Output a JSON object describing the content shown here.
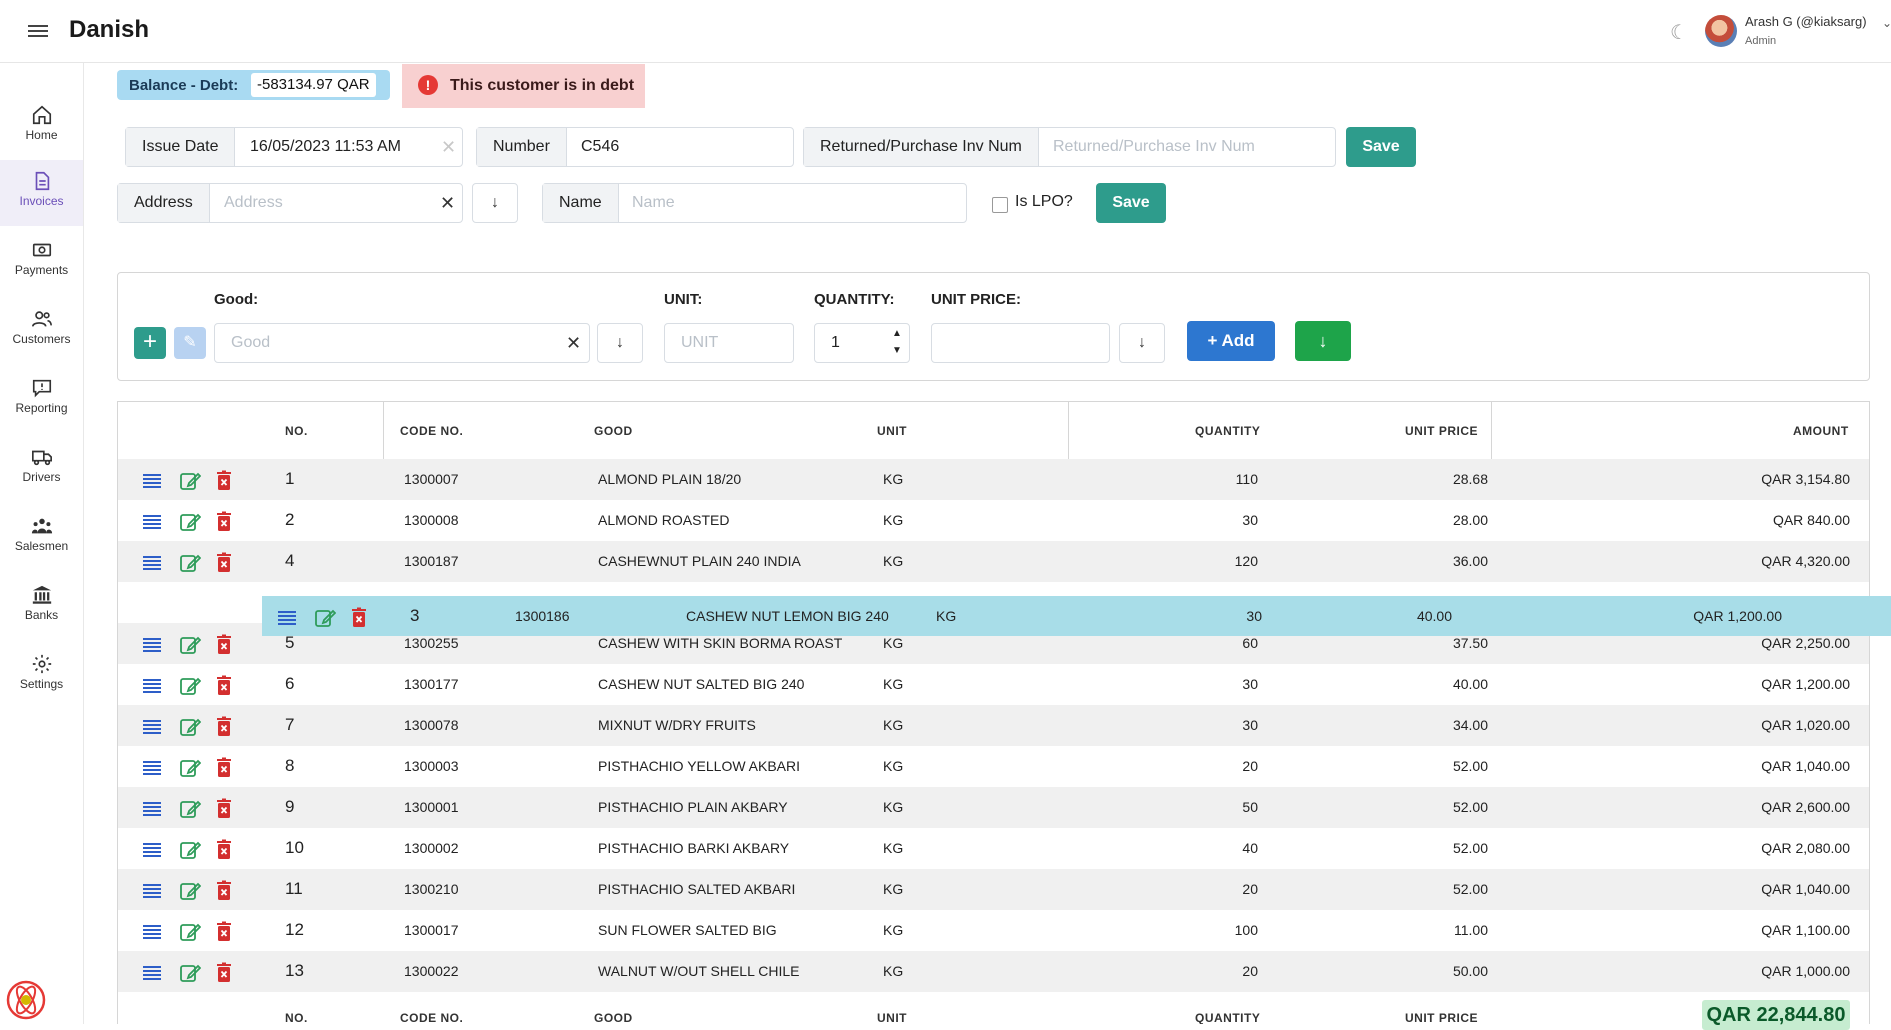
{
  "app": {
    "title": "Danish"
  },
  "user": {
    "name": "Arash G (@kiaksarg)",
    "role": "Admin"
  },
  "sidebar": {
    "items": [
      {
        "label": "Home",
        "icon": "home-icon"
      },
      {
        "label": "Invoices",
        "icon": "invoice-icon"
      },
      {
        "label": "Payments",
        "icon": "payments-icon"
      },
      {
        "label": "Customers",
        "icon": "customers-icon"
      },
      {
        "label": "Reporting",
        "icon": "reporting-icon"
      },
      {
        "label": "Drivers",
        "icon": "truck-icon"
      },
      {
        "label": "Salesmen",
        "icon": "salesmen-icon"
      },
      {
        "label": "Banks",
        "icon": "bank-icon"
      },
      {
        "label": "Settings",
        "icon": "gear-icon"
      }
    ],
    "active": "Invoices"
  },
  "balance": {
    "label": "Balance - Debt:",
    "value": "-583134.97 QAR"
  },
  "alert": {
    "text": "This customer is in debt",
    "color": "#f8d0d0"
  },
  "form": {
    "issue_date": {
      "label": "Issue Date",
      "value": "16/05/2023 11:53 AM"
    },
    "number": {
      "label": "Number",
      "value": "C546"
    },
    "returned": {
      "label": "Returned/Purchase Inv Num",
      "placeholder": "Returned/Purchase Inv Num"
    },
    "save_label": "Save",
    "address": {
      "label": "Address",
      "placeholder": "Address"
    },
    "name": {
      "label": "Name",
      "placeholder": "Name"
    },
    "lpo_label": "Is LPO?",
    "save2_label": "Save"
  },
  "good_form": {
    "good_label": "Good:",
    "good_placeholder": "Good",
    "unit_label": "UNIT:",
    "unit_placeholder": "UNIT",
    "quantity_label": "QUANTITY:",
    "quantity_value": "1",
    "price_label": "UNIT PRICE:",
    "add_label": "Add"
  },
  "table": {
    "headers": {
      "no": "NO.",
      "code": "CODE NO.",
      "good": "GOOD",
      "unit": "UNIT",
      "quantity": "QUANTITY",
      "price": "UNIT PRICE",
      "amount": "AMOUNT"
    },
    "rows": [
      {
        "no": "1",
        "code": "1300007",
        "good": "ALMOND PLAIN 18/20",
        "unit": "KG",
        "qty": "110",
        "price": "28.68",
        "amount": "QAR 3,154.80"
      },
      {
        "no": "2",
        "code": "1300008",
        "good": "ALMOND ROASTED",
        "unit": "KG",
        "qty": "30",
        "price": "28.00",
        "amount": "QAR 840.00"
      },
      {
        "no": "4",
        "code": "1300187",
        "good": "CASHEWNUT PLAIN 240 INDIA",
        "unit": "KG",
        "qty": "120",
        "price": "36.00",
        "amount": "QAR 4,320.00"
      },
      {
        "no": "",
        "code": "",
        "good": "",
        "unit": "",
        "qty": "",
        "price": "",
        "amount": ""
      },
      {
        "no": "5",
        "code": "1300255",
        "good": "CASHEW WITH SKIN BORMA ROAST",
        "unit": "KG",
        "qty": "60",
        "price": "37.50",
        "amount": "QAR 2,250.00"
      },
      {
        "no": "6",
        "code": "1300177",
        "good": "CASHEW NUT SALTED BIG 240",
        "unit": "KG",
        "qty": "30",
        "price": "40.00",
        "amount": "QAR 1,200.00"
      },
      {
        "no": "7",
        "code": "1300078",
        "good": "MIXNUT W/DRY FRUITS",
        "unit": "KG",
        "qty": "30",
        "price": "34.00",
        "amount": "QAR 1,020.00"
      },
      {
        "no": "8",
        "code": "1300003",
        "good": "PISTHACHIO YELLOW AKBARI",
        "unit": "KG",
        "qty": "20",
        "price": "52.00",
        "amount": "QAR 1,040.00"
      },
      {
        "no": "9",
        "code": "1300001",
        "good": "PISTHACHIO PLAIN AKBARY",
        "unit": "KG",
        "qty": "50",
        "price": "52.00",
        "amount": "QAR 2,600.00"
      },
      {
        "no": "10",
        "code": "1300002",
        "good": "PISTHACHIO BARKI AKBARY",
        "unit": "KG",
        "qty": "40",
        "price": "52.00",
        "amount": "QAR 2,080.00"
      },
      {
        "no": "11",
        "code": "1300210",
        "good": "PISTHACHIO SALTED AKBARI",
        "unit": "KG",
        "qty": "20",
        "price": "52.00",
        "amount": "QAR 1,040.00"
      },
      {
        "no": "12",
        "code": "1300017",
        "good": "SUN FLOWER SALTED BIG",
        "unit": "KG",
        "qty": "100",
        "price": "11.00",
        "amount": "QAR 1,100.00"
      },
      {
        "no": "13",
        "code": "1300022",
        "good": "WALNUT W/OUT SHELL CHILE",
        "unit": "KG",
        "qty": "20",
        "price": "50.00",
        "amount": "QAR 1,000.00"
      }
    ],
    "dragged_row": {
      "no": "3",
      "code": "1300186",
      "good": "CASHEW NUT LEMON BIG 240",
      "unit": "KG",
      "qty": "30",
      "price": "40.00",
      "amount": "QAR 1,200.00"
    },
    "total": "QAR 22,844.80"
  },
  "colors": {
    "accent": "#2e9c8c",
    "add": "#2d77d0",
    "green": "#1ea44a",
    "list_icon": "#2d5ec8",
    "edit_icon": "#2e9c5a",
    "delete_icon": "#d32f2f",
    "drag_row": "#a8dde8"
  }
}
